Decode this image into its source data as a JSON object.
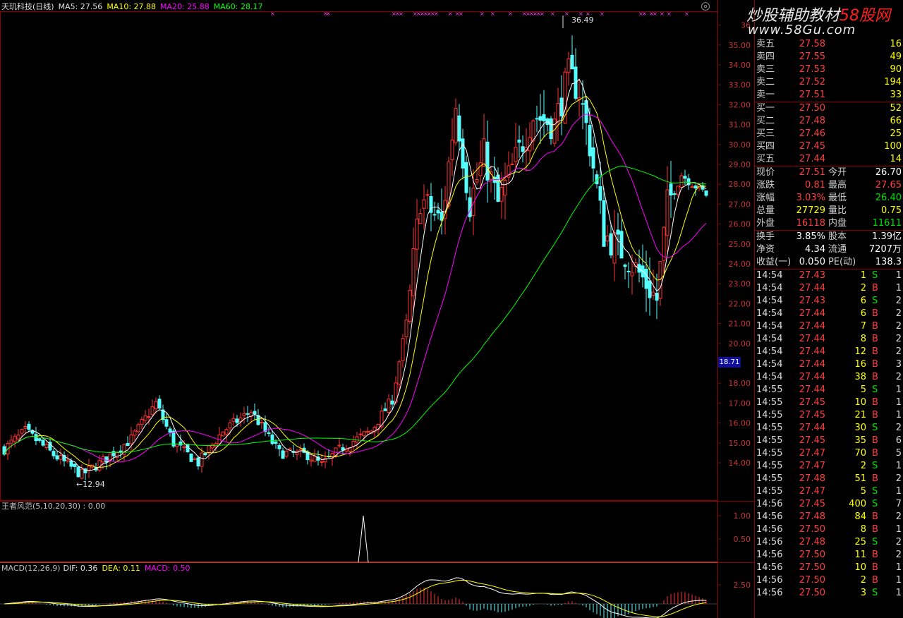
{
  "header": {
    "title": "天玑科技(日线)",
    "ma5": "MA5: 27.56",
    "ma10": "MA10: 27.88",
    "ma20": "MA20: 25.88",
    "ma60": "MA60: 28.17"
  },
  "indicator1": {
    "label": "王者风范(5,10,20,30) : 0.00",
    "ticks": [
      "1.00",
      "0.50"
    ]
  },
  "macd": {
    "label": "MACD(12,26,9)",
    "dif": "DIF: 0.36",
    "dea": "DEA: 0.11",
    "macd": "MACD: 0.50",
    "tick": "2.50"
  },
  "price_axis": {
    "ticks": [
      "36",
      "35.00",
      "34.00",
      "33.00",
      "32.00",
      "31.00",
      "30.00",
      "29.00",
      "28.00",
      "27.00",
      "26.00",
      "25.00",
      "24.00",
      "23.00",
      "22.00",
      "21.00",
      "20.00",
      "18.71",
      "18.00",
      "17.00",
      "16.00",
      "15.00",
      "14.00"
    ],
    "current_price_box": "18.71"
  },
  "annotations": {
    "high": "36.49",
    "low": "←12.94"
  },
  "watermark": {
    "line1_a": "炒股辅助教材",
    "line1_b": "58股网",
    "line2": "www.58Gu.com"
  },
  "colors": {
    "up": "#ff3232",
    "down": "#54ffff",
    "ma5": "#ffffff",
    "ma10": "#ffff00",
    "ma20": "#ff00ff",
    "ma60": "#00ff00",
    "price_red": "#ff4040",
    "volume_yellow": "#ffff00",
    "volume_green": "#00e000"
  },
  "orderbook": {
    "asks": [
      {
        "label": "卖五",
        "price": "27.58",
        "vol": "16"
      },
      {
        "label": "卖四",
        "price": "27.55",
        "vol": "49"
      },
      {
        "label": "卖三",
        "price": "27.53",
        "vol": "90"
      },
      {
        "label": "卖二",
        "price": "27.52",
        "vol": "194"
      },
      {
        "label": "卖一",
        "price": "27.51",
        "vol": "33"
      }
    ],
    "bids": [
      {
        "label": "买一",
        "price": "27.50",
        "vol": "52"
      },
      {
        "label": "买二",
        "price": "27.48",
        "vol": "66"
      },
      {
        "label": "买三",
        "price": "27.46",
        "vol": "25"
      },
      {
        "label": "买四",
        "price": "27.45",
        "vol": "100"
      },
      {
        "label": "买五",
        "price": "27.44",
        "vol": "14"
      }
    ]
  },
  "quote": [
    {
      "l1": "现价",
      "v1": "27.51",
      "l2": "今开",
      "v2": "26.70"
    },
    {
      "l1": "涨跌",
      "v1": "0.81",
      "l2": "最高",
      "v2": "27.65"
    },
    {
      "l1": "涨幅",
      "v1": "3.03%",
      "l2": "最低",
      "v2": "26.40"
    },
    {
      "l1": "总量",
      "v1": "27729",
      "l2": "量比",
      "v2": "0.75"
    },
    {
      "l1": "外盘",
      "v1": "16118",
      "l2": "内盘",
      "v2": "11611"
    }
  ],
  "stats": [
    {
      "l1": "换手",
      "v1": "3.85%",
      "l2": "股本",
      "v2": "1.39亿"
    },
    {
      "l1": "净资",
      "v1": "4.34",
      "l2": "流通",
      "v2": "7207万"
    },
    {
      "l1": "收益(一)",
      "v1": "0.050",
      "l2": "PE(动)",
      "v2": "138.3"
    }
  ],
  "ticks": [
    {
      "t": "14:54",
      "p": "27.43",
      "v": "1",
      "bs": "S",
      "n": "1"
    },
    {
      "t": "14:54",
      "p": "27.44",
      "v": "2",
      "bs": "B",
      "n": "1"
    },
    {
      "t": "14:54",
      "p": "27.43",
      "v": "6",
      "bs": "S",
      "n": "2"
    },
    {
      "t": "14:54",
      "p": "27.44",
      "v": "6",
      "bs": "B",
      "n": "2"
    },
    {
      "t": "14:54",
      "p": "27.44",
      "v": "7",
      "bs": "B",
      "n": "2"
    },
    {
      "t": "14:54",
      "p": "27.44",
      "v": "8",
      "bs": "B",
      "n": "2"
    },
    {
      "t": "14:54",
      "p": "27.44",
      "v": "12",
      "bs": "B",
      "n": "2"
    },
    {
      "t": "14:54",
      "p": "27.44",
      "v": "16",
      "bs": "B",
      "n": "3"
    },
    {
      "t": "14:54",
      "p": "27.44",
      "v": "38",
      "bs": "B",
      "n": "2"
    },
    {
      "t": "14:55",
      "p": "27.44",
      "v": "5",
      "bs": "S",
      "n": "1"
    },
    {
      "t": "14:55",
      "p": "27.45",
      "v": "10",
      "bs": "B",
      "n": "1"
    },
    {
      "t": "14:55",
      "p": "27.45",
      "v": "21",
      "bs": "B",
      "n": "1"
    },
    {
      "t": "14:55",
      "p": "27.44",
      "v": "30",
      "bs": "S",
      "n": "2"
    },
    {
      "t": "14:55",
      "p": "27.45",
      "v": "35",
      "bs": "B",
      "n": "6"
    },
    {
      "t": "14:55",
      "p": "27.47",
      "v": "70",
      "bs": "B",
      "n": "5"
    },
    {
      "t": "14:55",
      "p": "27.47",
      "v": "2",
      "bs": "S",
      "n": "1"
    },
    {
      "t": "14:55",
      "p": "27.48",
      "v": "51",
      "bs": "B",
      "n": "2"
    },
    {
      "t": "14:55",
      "p": "27.47",
      "v": "5",
      "bs": "S",
      "n": "1"
    },
    {
      "t": "14:56",
      "p": "27.45",
      "v": "400",
      "bs": "S",
      "n": "7"
    },
    {
      "t": "14:56",
      "p": "27.48",
      "v": "84",
      "bs": "B",
      "n": "2"
    },
    {
      "t": "14:56",
      "p": "27.50",
      "v": "8",
      "bs": "B",
      "n": "1"
    },
    {
      "t": "14:56",
      "p": "27.48",
      "v": "25",
      "bs": "S",
      "n": "2"
    },
    {
      "t": "14:56",
      "p": "27.50",
      "v": "11",
      "bs": "B",
      "n": "2"
    },
    {
      "t": "14:56",
      "p": "27.50",
      "v": "10",
      "bs": "B",
      "n": "1"
    },
    {
      "t": "14:56",
      "p": "27.50",
      "v": "2",
      "bs": "B",
      "n": "1"
    },
    {
      "t": "14:56",
      "p": "27.50",
      "v": "3",
      "bs": "S",
      "n": "1"
    }
  ]
}
